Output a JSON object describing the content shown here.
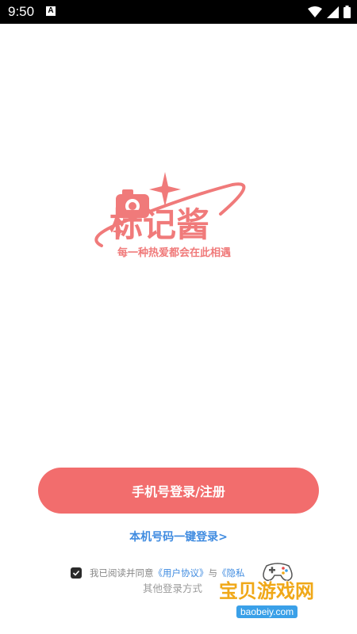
{
  "status_bar": {
    "time": "9:50",
    "notification_letter": "A",
    "icons": [
      "wifi-icon",
      "signal-icon",
      "battery-icon"
    ]
  },
  "logo": {
    "name": "标记酱",
    "slogan": "每一种热爱都会在此相遇",
    "color": "#f07a7a"
  },
  "login": {
    "phone_button_label": "手机号登录/注册",
    "one_click_label": "本机号码一键登录>",
    "other_login_label": "其他登录方式"
  },
  "agreement": {
    "checked": true,
    "prefix": "我已阅读并同意",
    "user_agreement": "《用户协议》",
    "connector": "与",
    "privacy_partial": "《隐私"
  },
  "watermark": {
    "title": "宝贝游戏网",
    "url": "baobeiy.com"
  },
  "colors": {
    "primary": "#f26d6d",
    "link": "#3f8be0",
    "muted": "#888888"
  }
}
